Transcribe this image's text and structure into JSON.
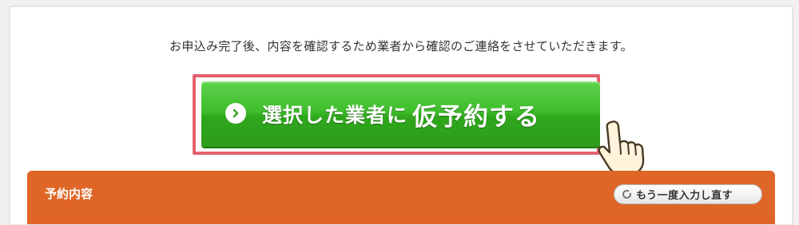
{
  "notice": {
    "text": "お申込み完了後、内容を確認するため業者から確認のご連絡をさせていただきます。"
  },
  "cta": {
    "label_main": "選択した業者に",
    "label_emphasis": "仮予約する",
    "icon": "chevron-circle-right-icon",
    "color": "#3fbd2c"
  },
  "highlight": {
    "color": "#e5616d"
  },
  "pointer": {
    "icon": "pointing-hand-icon"
  },
  "section": {
    "title": "予約内容",
    "color": "#e06628",
    "redo_button_label": "もう一度入力し直す",
    "redo_icon": "refresh-icon"
  }
}
